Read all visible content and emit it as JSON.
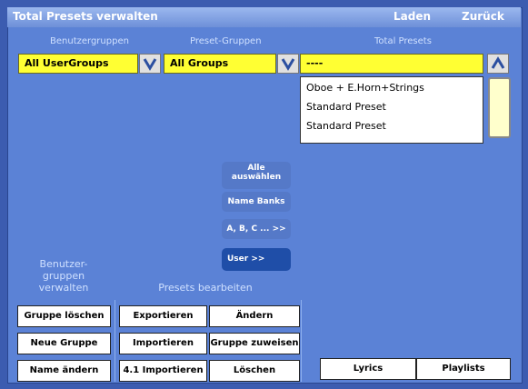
{
  "window": {
    "title": "Total Presets verwalten",
    "load_label": "Laden",
    "back_label": "Zurück"
  },
  "columns": {
    "usergroups": "Benutzergruppen",
    "preset_groups": "Preset-Gruppen",
    "total_presets": "Total Presets"
  },
  "selects": {
    "usergroups_value": "All UserGroups",
    "preset_groups_value": "All Groups",
    "total_presets_value": "----"
  },
  "presets": {
    "items": [
      "Oboe + E.Horn+Strings",
      "Standard Preset",
      "Standard Preset"
    ]
  },
  "middle": {
    "select_all_line1": "Alle",
    "select_all_line2": "auswählen",
    "name_banks": "Name Banks",
    "abc": "A, B, C ... >>",
    "user": "User >>"
  },
  "sections": {
    "manage_usergroups_line1": "Benutzer-",
    "manage_usergroups_line2": "gruppen",
    "manage_usergroups_line3": "verwalten",
    "edit_presets": "Presets bearbeiten"
  },
  "buttons": {
    "delete_group": "Gruppe löschen",
    "new_group": "Neue Gruppe",
    "rename": "Name ändern",
    "export": "Exportieren",
    "import": "Importieren",
    "import41": "4.1 Importieren",
    "change": "Ändern",
    "assign_group": "Gruppe zuweisen",
    "delete": "Löschen",
    "lyrics": "Lyrics",
    "playlists": "Playlists"
  }
}
